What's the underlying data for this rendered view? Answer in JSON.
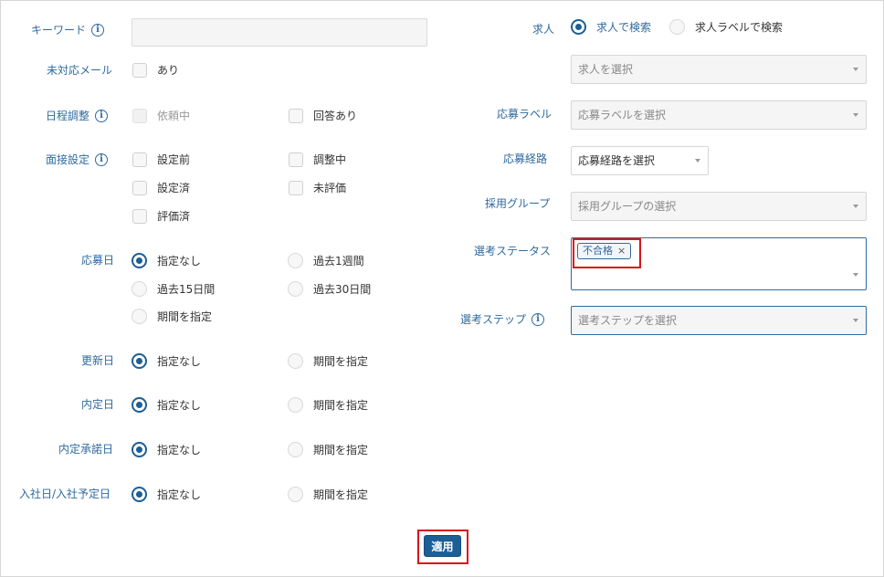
{
  "labels": {
    "keyword": "キーワード",
    "unresponded_mail": "未対応メール",
    "schedule": "日程調整",
    "interview_setting": "面接設定",
    "applied_date": "応募日",
    "updated_date": "更新日",
    "offer_date": "内定日",
    "offer_accept_date": "内定承諾日",
    "join_date": "入社日/入社予定日",
    "job": "求人",
    "applicant_label": "応募ラベル",
    "applicant_route": "応募経路",
    "hiring_group": "採用グループ",
    "selection_status": "選考ステータス",
    "selection_step": "選考ステップ"
  },
  "keyword": {
    "value": "",
    "placeholder": ""
  },
  "unresponded_mail": {
    "option": "あり",
    "checked": false
  },
  "schedule": {
    "options": [
      "依頼中",
      "回答あり"
    ]
  },
  "interview_setting": {
    "options": [
      "設定前",
      "調整中",
      "設定済",
      "未評価",
      "評価済"
    ]
  },
  "applied_date": {
    "options": [
      "指定なし",
      "過去1週間",
      "過去15日間",
      "過去30日間",
      "期間を指定"
    ],
    "selected": "指定なし"
  },
  "updated_date": {
    "options": [
      "指定なし",
      "期間を指定"
    ],
    "selected": "指定なし"
  },
  "offer_date": {
    "options": [
      "指定なし",
      "期間を指定"
    ],
    "selected": "指定なし"
  },
  "offer_accept_date": {
    "options": [
      "指定なし",
      "期間を指定"
    ],
    "selected": "指定なし"
  },
  "join_date": {
    "options": [
      "指定なし",
      "期間を指定"
    ],
    "selected": "指定なし"
  },
  "job": {
    "search_modes": [
      "求人で検索",
      "求人ラベルで検索"
    ],
    "selected_mode": "求人で検索",
    "select_placeholder": "求人を選択"
  },
  "applicant_label": {
    "placeholder": "応募ラベルを選択"
  },
  "applicant_route": {
    "placeholder": "応募経路を選択"
  },
  "hiring_group": {
    "placeholder": "採用グループの選択"
  },
  "selection_status": {
    "tags": [
      "不合格"
    ],
    "remove_glyph": "×"
  },
  "selection_step": {
    "placeholder": "選考ステップを選択"
  },
  "apply_button": "適用",
  "info_icon_glyph": "i",
  "colors": {
    "label": "#2f6aa0",
    "accent": "#1c5e96",
    "highlight": "#d9141b"
  }
}
